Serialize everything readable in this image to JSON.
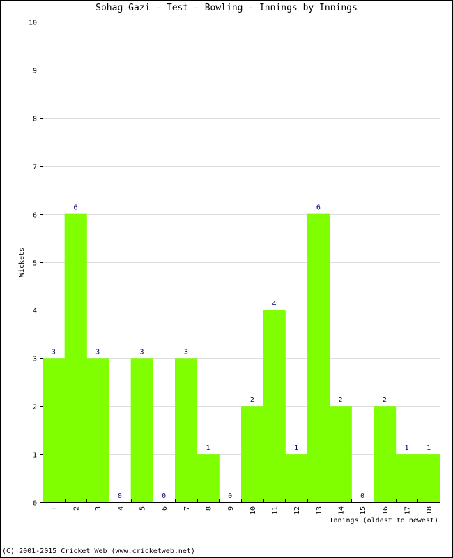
{
  "chart_data": {
    "type": "bar",
    "title": "Sohag Gazi - Test - Bowling - Innings by Innings",
    "xlabel": "Innings (oldest to newest)",
    "ylabel": "Wickets",
    "categories": [
      "1",
      "2",
      "3",
      "4",
      "5",
      "6",
      "7",
      "8",
      "9",
      "10",
      "11",
      "12",
      "13",
      "14",
      "15",
      "16",
      "17",
      "18"
    ],
    "values": [
      3,
      6,
      3,
      0,
      3,
      0,
      3,
      1,
      0,
      2,
      4,
      1,
      6,
      2,
      0,
      2,
      1,
      1
    ],
    "ylim": [
      0,
      10
    ],
    "yticks": [
      0,
      1,
      2,
      3,
      4,
      5,
      6,
      7,
      8,
      9,
      10
    ],
    "grid": true,
    "legend": "none",
    "bar_color": "#80ff00",
    "label_color": "#000080",
    "grid_color": "#dddddd"
  },
  "footer": "(C) 2001-2015 Cricket Web (www.cricketweb.net)"
}
